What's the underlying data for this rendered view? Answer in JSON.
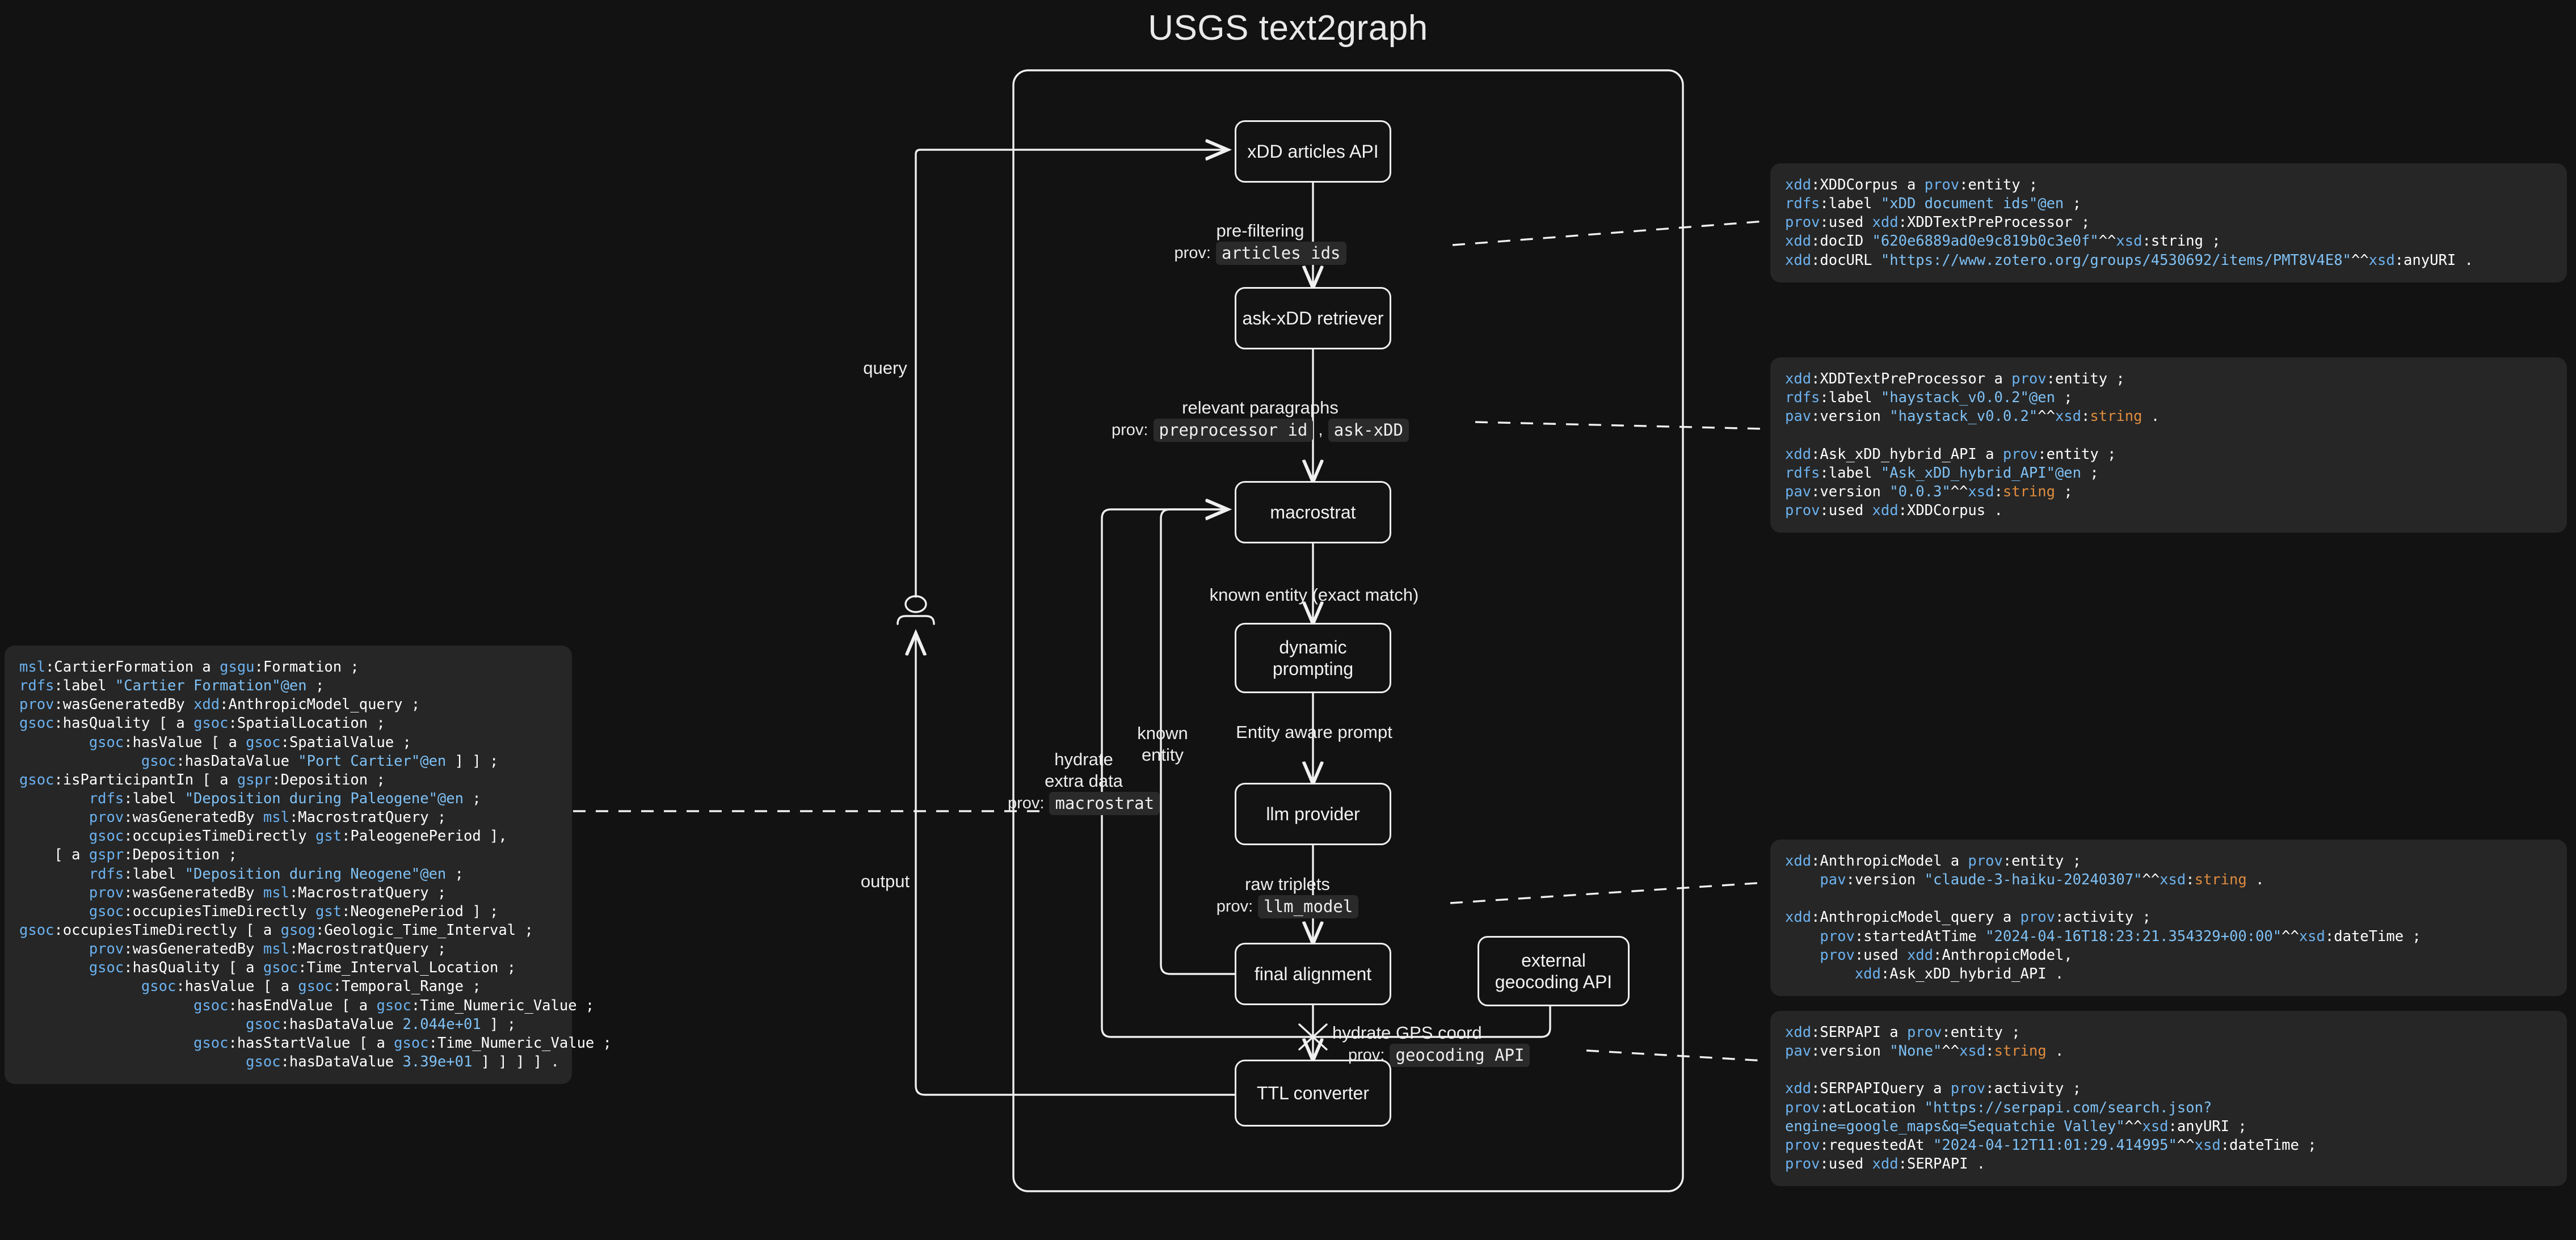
{
  "title": "USGS text2graph",
  "nodes": {
    "xdd_articles_api": "xDD articles API",
    "ask_xdd_retriever": "ask-xDD retriever",
    "macrostrat": "macrostrat",
    "dynamic_prompting": "dynamic\nprompting",
    "llm_provider": "llm provider",
    "final_alignment": "final alignment",
    "ttl_converter": "TTL converter",
    "geocoding_api": "external\ngeocoding API"
  },
  "edges": {
    "query": "query",
    "output": "output",
    "prefiltering": {
      "text": "pre-filtering",
      "prov_key": "prov:",
      "chips": [
        "articles ids"
      ]
    },
    "relevant_paragraphs": {
      "text": "relevant paragraphs",
      "prov_key": "prov:",
      "chips": [
        "preprocessor id",
        "ask-xDD"
      ],
      "separator": ","
    },
    "known_entity_exact": {
      "text": "known entity (exact match)"
    },
    "entity_aware_prompt": {
      "text": "Entity aware prompt"
    },
    "raw_triplets": {
      "text": "raw triplets",
      "prov_key": "prov:",
      "chips": [
        "llm_model"
      ]
    },
    "hydrate_extra_data": {
      "text": "hydrate\nextra data",
      "prov_key": "prov:",
      "chips": [
        "macrostrat"
      ]
    },
    "known_entity": {
      "text": "known\nentity"
    },
    "hydrate_gps_coord": {
      "text": "hydrate GPS coord",
      "prov_key": "prov:",
      "chips": [
        "geocoding API"
      ]
    }
  },
  "code_blocks": {
    "cartier_formation": {
      "lines": [
        [
          [
            "msl",
            "b"
          ],
          [
            ":CartierFormation a ",
            "w"
          ],
          [
            "gsgu",
            "b"
          ],
          [
            ":Formation ;",
            "w"
          ]
        ],
        [
          [
            "rdfs",
            "b"
          ],
          [
            ":label ",
            "w"
          ],
          [
            "\"Cartier Formation\"@en",
            "l"
          ],
          [
            " ;",
            "w"
          ]
        ],
        [
          [
            "prov",
            "b"
          ],
          [
            ":wasGeneratedBy ",
            "w"
          ],
          [
            "xdd",
            "b"
          ],
          [
            ":AnthropicModel_query ;",
            "w"
          ]
        ],
        [
          [
            "gsoc",
            "b"
          ],
          [
            ":hasQuality [ a ",
            "w"
          ],
          [
            "gsoc",
            "b"
          ],
          [
            ":SpatialLocation ;",
            "w"
          ]
        ],
        [
          [
            "        gsoc",
            "b"
          ],
          [
            ":hasValue [ a ",
            "w"
          ],
          [
            "gsoc",
            "b"
          ],
          [
            ":SpatialValue ;",
            "w"
          ]
        ],
        [
          [
            "              gsoc",
            "b"
          ],
          [
            ":hasDataValue ",
            "w"
          ],
          [
            "\"Port Cartier\"@en",
            "l"
          ],
          [
            " ] ] ;",
            "w"
          ]
        ],
        [
          [
            "gsoc",
            "b"
          ],
          [
            ":isParticipantIn [ a ",
            "w"
          ],
          [
            "gspr",
            "b"
          ],
          [
            ":Deposition ;",
            "w"
          ]
        ],
        [
          [
            "        rdfs",
            "b"
          ],
          [
            ":label ",
            "w"
          ],
          [
            "\"Deposition during Paleogene\"@en",
            "l"
          ],
          [
            " ;",
            "w"
          ]
        ],
        [
          [
            "        prov",
            "b"
          ],
          [
            ":wasGeneratedBy ",
            "w"
          ],
          [
            "msl",
            "b"
          ],
          [
            ":MacrostratQuery ;",
            "w"
          ]
        ],
        [
          [
            "        gsoc",
            "b"
          ],
          [
            ":occupiesTimeDirectly ",
            "w"
          ],
          [
            "gst",
            "b"
          ],
          [
            ":PaleogenePeriod ],",
            "w"
          ]
        ],
        [
          [
            "    [ a ",
            "w"
          ],
          [
            "gspr",
            "b"
          ],
          [
            ":Deposition ;",
            "w"
          ]
        ],
        [
          [
            "        rdfs",
            "b"
          ],
          [
            ":label ",
            "w"
          ],
          [
            "\"Deposition during Neogene\"@en",
            "l"
          ],
          [
            " ;",
            "w"
          ]
        ],
        [
          [
            "        prov",
            "b"
          ],
          [
            ":wasGeneratedBy ",
            "w"
          ],
          [
            "msl",
            "b"
          ],
          [
            ":MacrostratQuery ;",
            "w"
          ]
        ],
        [
          [
            "        gsoc",
            "b"
          ],
          [
            ":occupiesTimeDirectly ",
            "w"
          ],
          [
            "gst",
            "b"
          ],
          [
            ":NeogenePeriod ] ;",
            "w"
          ]
        ],
        [
          [
            "gsoc",
            "b"
          ],
          [
            ":occupiesTimeDirectly [ a ",
            "w"
          ],
          [
            "gsog",
            "b"
          ],
          [
            ":Geologic_Time_Interval ;",
            "w"
          ]
        ],
        [
          [
            "        prov",
            "b"
          ],
          [
            ":wasGeneratedBy ",
            "w"
          ],
          [
            "msl",
            "b"
          ],
          [
            ":MacrostratQuery ;",
            "w"
          ]
        ],
        [
          [
            "        gsoc",
            "b"
          ],
          [
            ":hasQuality [ a ",
            "w"
          ],
          [
            "gsoc",
            "b"
          ],
          [
            ":Time_Interval_Location ;",
            "w"
          ]
        ],
        [
          [
            "              gsoc",
            "b"
          ],
          [
            ":hasValue [ a ",
            "w"
          ],
          [
            "gsoc",
            "b"
          ],
          [
            ":Temporal_Range ;",
            "w"
          ]
        ],
        [
          [
            "                    gsoc",
            "b"
          ],
          [
            ":hasEndValue [ a ",
            "w"
          ],
          [
            "gsoc",
            "b"
          ],
          [
            ":Time_Numeric_Value ;",
            "w"
          ]
        ],
        [
          [
            "                          gsoc",
            "b"
          ],
          [
            ":hasDataValue ",
            "w"
          ],
          [
            "2.044e+01",
            "l"
          ],
          [
            " ] ;",
            "w"
          ]
        ],
        [
          [
            "                    gsoc",
            "b"
          ],
          [
            ":hasStartValue [ a ",
            "w"
          ],
          [
            "gsoc",
            "b"
          ],
          [
            ":Time_Numeric_Value ;",
            "w"
          ]
        ],
        [
          [
            "                          gsoc",
            "b"
          ],
          [
            ":hasDataValue ",
            "w"
          ],
          [
            "3.39e+01",
            "l"
          ],
          [
            " ] ] ] ] .",
            "w"
          ]
        ]
      ]
    },
    "xdd_corpus": {
      "lines": [
        [
          [
            "xdd",
            "b"
          ],
          [
            ":XDDCorpus a ",
            "w"
          ],
          [
            "prov",
            "b"
          ],
          [
            ":entity ;",
            "w"
          ]
        ],
        [
          [
            "rdfs",
            "b"
          ],
          [
            ":label ",
            "w"
          ],
          [
            "\"xDD document ids\"@en",
            "l"
          ],
          [
            " ;",
            "w"
          ]
        ],
        [
          [
            "prov",
            "b"
          ],
          [
            ":used ",
            "w"
          ],
          [
            "xdd",
            "b"
          ],
          [
            ":XDDTextPreProcessor ;",
            "w"
          ]
        ],
        [
          [
            "xdd",
            "b"
          ],
          [
            ":docID ",
            "w"
          ],
          [
            "\"620e6889ad0e9c819b0c3e0f\"",
            "l"
          ],
          [
            "^^",
            "w"
          ],
          [
            "xsd",
            "b"
          ],
          [
            ":string ;",
            "w"
          ]
        ],
        [
          [
            "xdd",
            "b"
          ],
          [
            ":docURL ",
            "w"
          ],
          [
            "\"https://www.zotero.org/groups/4530692/items/PMT8V4E8\"",
            "l"
          ],
          [
            "^^",
            "w"
          ],
          [
            "xsd",
            "b"
          ],
          [
            ":anyURI .",
            "w"
          ]
        ]
      ]
    },
    "preprocessor": {
      "lines": [
        [
          [
            "xdd",
            "b"
          ],
          [
            ":XDDTextPreProcessor a ",
            "w"
          ],
          [
            "prov",
            "b"
          ],
          [
            ":entity ;",
            "w"
          ]
        ],
        [
          [
            "rdfs",
            "b"
          ],
          [
            ":label ",
            "w"
          ],
          [
            "\"haystack_v0.0.2\"@en",
            "l"
          ],
          [
            " ;",
            "w"
          ]
        ],
        [
          [
            "pav",
            "b"
          ],
          [
            ":version ",
            "w"
          ],
          [
            "\"haystack_v0.0.2\"",
            "l"
          ],
          [
            "^^",
            "w"
          ],
          [
            "xsd",
            "b"
          ],
          [
            ":",
            "w"
          ],
          [
            "string",
            "o"
          ],
          [
            " .",
            "w"
          ]
        ],
        [
          [
            "",
            ""
          ]
        ],
        [
          [
            "xdd",
            "b"
          ],
          [
            ":Ask_xDD_hybrid_API a ",
            "w"
          ],
          [
            "prov",
            "b"
          ],
          [
            ":entity ;",
            "w"
          ]
        ],
        [
          [
            "rdfs",
            "b"
          ],
          [
            ":label ",
            "w"
          ],
          [
            "\"Ask_xDD_hybrid_API\"@en",
            "l"
          ],
          [
            " ;",
            "w"
          ]
        ],
        [
          [
            "pav",
            "b"
          ],
          [
            ":version ",
            "w"
          ],
          [
            "\"0.0.3\"",
            "l"
          ],
          [
            "^^",
            "w"
          ],
          [
            "xsd",
            "b"
          ],
          [
            ":",
            "w"
          ],
          [
            "string",
            "o"
          ],
          [
            " ;",
            "w"
          ]
        ],
        [
          [
            "prov",
            "b"
          ],
          [
            ":used ",
            "w"
          ],
          [
            "xdd",
            "b"
          ],
          [
            ":XDDCorpus .",
            "w"
          ]
        ]
      ]
    },
    "anthropic": {
      "lines": [
        [
          [
            "xdd",
            "b"
          ],
          [
            ":AnthropicModel a ",
            "w"
          ],
          [
            "prov",
            "b"
          ],
          [
            ":entity ;",
            "w"
          ]
        ],
        [
          [
            "    pav",
            "b"
          ],
          [
            ":version ",
            "w"
          ],
          [
            "\"claude-3-haiku-20240307\"",
            "l"
          ],
          [
            "^^",
            "w"
          ],
          [
            "xsd",
            "b"
          ],
          [
            ":",
            "w"
          ],
          [
            "string",
            "o"
          ],
          [
            " .",
            "w"
          ]
        ],
        [
          [
            "",
            ""
          ]
        ],
        [
          [
            "xdd",
            "b"
          ],
          [
            ":AnthropicModel_query a ",
            "w"
          ],
          [
            "prov",
            "b"
          ],
          [
            ":activity ;",
            "w"
          ]
        ],
        [
          [
            "    prov",
            "b"
          ],
          [
            ":startedAtTime ",
            "w"
          ],
          [
            "\"2024-04-16T18:23:21.354329+00:00\"",
            "l"
          ],
          [
            "^^",
            "w"
          ],
          [
            "xsd",
            "b"
          ],
          [
            ":dateTime ;",
            "w"
          ]
        ],
        [
          [
            "    prov",
            "b"
          ],
          [
            ":used ",
            "w"
          ],
          [
            "xdd",
            "b"
          ],
          [
            ":AnthropicModel,",
            "w"
          ]
        ],
        [
          [
            "        xdd",
            "b"
          ],
          [
            ":Ask_xDD_hybrid_API .",
            "w"
          ]
        ]
      ]
    },
    "serpapi": {
      "lines": [
        [
          [
            "xdd",
            "b"
          ],
          [
            ":SERPAPI a ",
            "w"
          ],
          [
            "prov",
            "b"
          ],
          [
            ":entity ;",
            "w"
          ]
        ],
        [
          [
            "pav",
            "b"
          ],
          [
            ":version ",
            "w"
          ],
          [
            "\"None\"",
            "l"
          ],
          [
            "^^",
            "w"
          ],
          [
            "xsd",
            "b"
          ],
          [
            ":",
            "w"
          ],
          [
            "string",
            "o"
          ],
          [
            " .",
            "w"
          ]
        ],
        [
          [
            "",
            ""
          ]
        ],
        [
          [
            "xdd",
            "b"
          ],
          [
            ":SERPAPIQuery a ",
            "w"
          ],
          [
            "prov",
            "b"
          ],
          [
            ":activity ;",
            "w"
          ]
        ],
        [
          [
            "prov",
            "b"
          ],
          [
            ":atLocation ",
            "w"
          ],
          [
            "\"https://serpapi.com/search.json?",
            "l"
          ]
        ],
        [
          [
            "engine=google_maps&q=Sequatchie Valley\"",
            "l"
          ],
          [
            "^^",
            "w"
          ],
          [
            "xsd",
            "b"
          ],
          [
            ":anyURI ;",
            "w"
          ]
        ],
        [
          [
            "prov",
            "b"
          ],
          [
            ":requestedAt ",
            "w"
          ],
          [
            "\"2024-04-12T11:01:29.414995\"",
            "l"
          ],
          [
            "^^",
            "w"
          ],
          [
            "xsd",
            "b"
          ],
          [
            ":dateTime ;",
            "w"
          ]
        ],
        [
          [
            "prov",
            "b"
          ],
          [
            ":used ",
            "w"
          ],
          [
            "xdd",
            "b"
          ],
          [
            ":SERPAPI .",
            "w"
          ]
        ]
      ]
    }
  },
  "colors": {
    "background": "#121212",
    "panel": "#262626",
    "stroke": "#f0f0f0",
    "blue": "#6cb2f0",
    "light_blue": "#7fc1f5",
    "orange": "#e08c3f"
  }
}
